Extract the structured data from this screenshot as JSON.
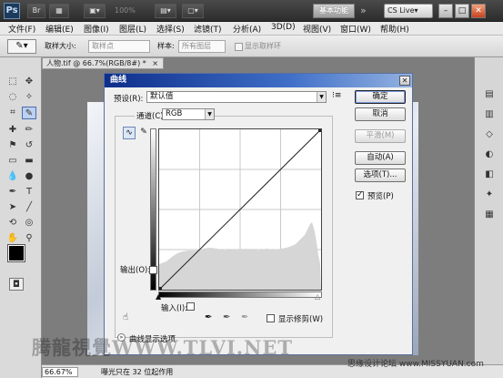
{
  "app": {
    "logo": "Ps",
    "zoom": "100%",
    "workspace": "基本功能",
    "more": "»",
    "cslive": "CS Live▾",
    "window_buttons": [
      "–",
      "□",
      "✕"
    ]
  },
  "menu": [
    "文件(F)",
    "编辑(E)",
    "图像(I)",
    "图层(L)",
    "选择(S)",
    "滤镜(T)",
    "分析(A)",
    "3D(D)",
    "视图(V)",
    "窗口(W)",
    "帮助(H)"
  ],
  "options": {
    "sample_size_label": "取样大小:",
    "sample_size_value": "取样点",
    "sample_label": "样本:",
    "sample_value": "所有图层",
    "show_ring_label": "显示取样环"
  },
  "document": {
    "tab_title": "人物.tif @ 66.7%(RGB/8#) *",
    "tab_close": "×"
  },
  "status": {
    "zoom": "66.67%",
    "message": "曝光只在 32 位起作用"
  },
  "dialog": {
    "title": "曲线",
    "close": "✕",
    "preset_label": "预设(R):",
    "preset_value": "默认值",
    "channel_label": "通道(C):",
    "channel_value": "RGB",
    "output_label": "输出(O):",
    "input_label": "输入(I):",
    "show_clipping_label": "显示修剪(W)",
    "curve_options_label": "曲线显示选项",
    "preview_label": "预览(P)",
    "preview_checked": true,
    "buttons": {
      "ok": "确定",
      "cancel": "取消",
      "smooth": "平滑(M)",
      "auto": "自动(A)",
      "options": "选项(T)..."
    }
  },
  "watermark": {
    "text": "腾龍視覺WWW.TLVI.NET",
    "site": "思缘设计论坛 www.MISSYUAN.com"
  }
}
